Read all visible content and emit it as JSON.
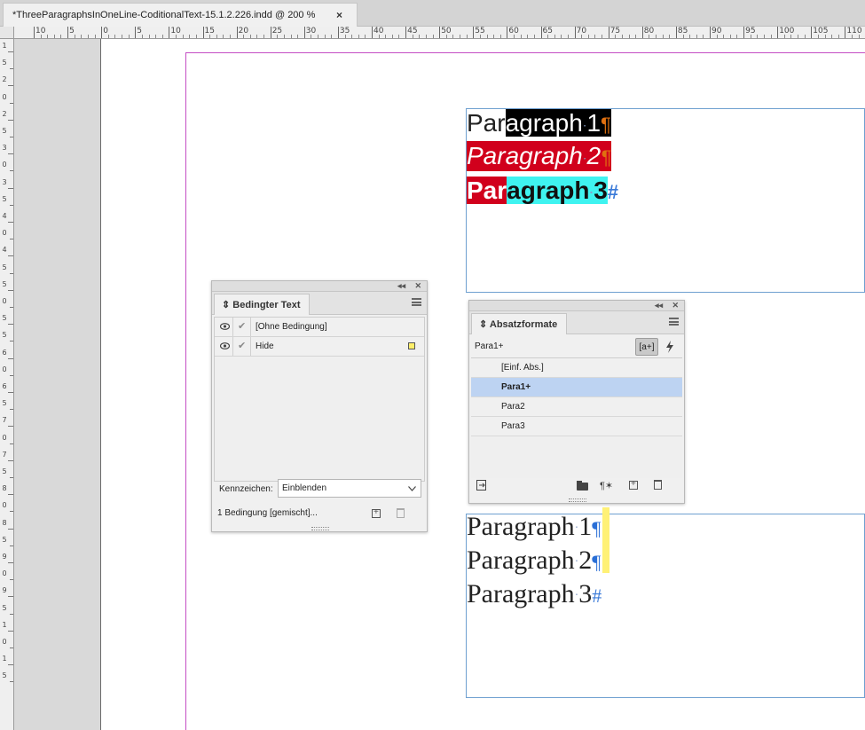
{
  "document": {
    "tab_title": "*ThreeParagraphsInOneLine-CoditionalText-15.1.2.226.indd @ 200 %",
    "close_glyph": "×"
  },
  "ruler": {
    "horizontal_labels": [
      "10",
      "5",
      "0",
      "5",
      "10",
      "15",
      "20",
      "25",
      "30",
      "35",
      "40",
      "45",
      "50",
      "55",
      "60",
      "65",
      "70",
      "75",
      "80",
      "85",
      "90",
      "95",
      "100",
      "105",
      "110"
    ],
    "vertical_labels": [
      "1",
      "5",
      "2",
      "0",
      "2",
      "5",
      "3",
      "0",
      "3",
      "5",
      "4",
      "0",
      "4",
      "5",
      "5",
      "0",
      "5",
      "5",
      "6",
      "0",
      "6",
      "5",
      "7",
      "0",
      "7",
      "5",
      "8",
      "0",
      "8",
      "5",
      "9",
      "0",
      "9",
      "5",
      "1",
      "0",
      "1",
      "5"
    ]
  },
  "marks": {
    "space_dot": "·",
    "pilcrow": "¶",
    "end_of_story": "#"
  },
  "frame_top": {
    "p1_plain": "Par",
    "p1_hl": "agraph",
    "p1_num": "1",
    "p2_word": "Paragraph",
    "p2_num": "2",
    "p3_red": "Par",
    "p3_cyan": "agraph",
    "p3_num": "3"
  },
  "frame_bottom": {
    "p_word": "Paragraph",
    "p1_num": "1",
    "p2_num": "2",
    "p3_num": "3"
  },
  "colors": {
    "highlight_black": "#000000",
    "highlight_red": "#d1001c",
    "highlight_cyan": "#3ff3f0",
    "condition_yellow": "#ffef6a",
    "selected_row": "#bdd3f2",
    "margin_guide": "#c44ec4",
    "frame_edge": "#6fa0d0"
  },
  "panel_controls": {
    "collapse": "◂◂",
    "close": "✕",
    "tab_arrows": "⇕",
    "check": "✔"
  },
  "conditional_panel": {
    "title": "Bedingter Text",
    "conditions": [
      {
        "label": "[Ohne Bedingung]",
        "visible": true
      },
      {
        "label": "Hide",
        "visible": true,
        "color": "#ffef6a"
      }
    ],
    "indicator_label": "Kennzeichen:",
    "indicator_value": "Einblenden",
    "status": "1 Bedingung  [gemischt]..."
  },
  "paragraph_panel": {
    "title": "Absatzformate",
    "current_style": "Para1+",
    "new_style_button": "[a+]",
    "styles": [
      "[Einf. Abs.]",
      "Para1+",
      "Para2",
      "Para3"
    ],
    "selected_style": "Para1+",
    "clear_override_glyph": "¶✶"
  }
}
